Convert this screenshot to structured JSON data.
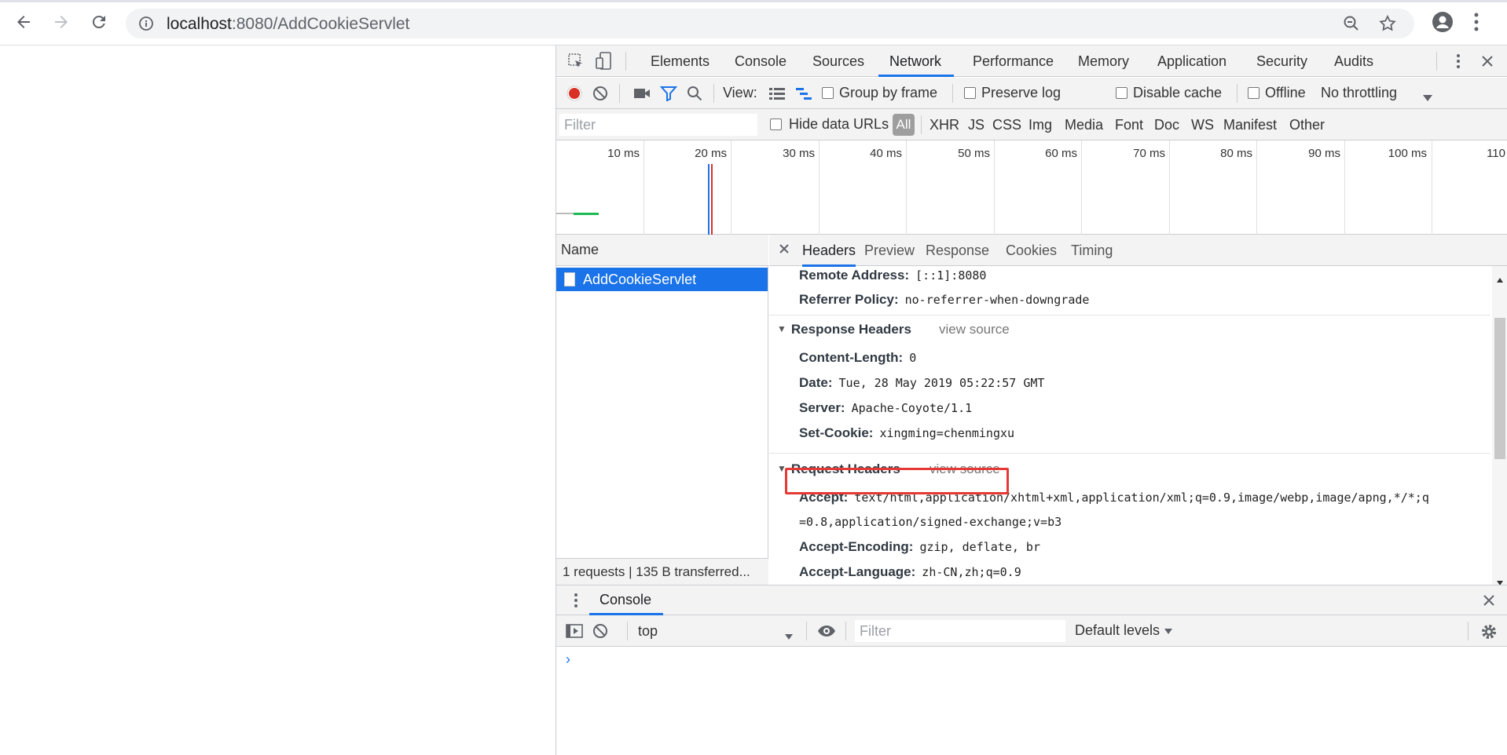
{
  "browser": {
    "url_host": "localhost",
    "url_rest": ":8080/AddCookieServlet"
  },
  "devtools": {
    "panel_tabs": [
      "Elements",
      "Console",
      "Sources",
      "Network",
      "Performance",
      "Memory",
      "Application",
      "Security",
      "Audits"
    ],
    "active_tab": "Network",
    "toolbar": {
      "view_label": "View:",
      "group_by_frame": "Group by frame",
      "preserve_log": "Preserve log",
      "disable_cache": "Disable cache",
      "offline": "Offline",
      "throttling": "No throttling"
    },
    "filter": {
      "placeholder": "Filter",
      "hide_data_urls": "Hide data URLs",
      "types": [
        "All",
        "XHR",
        "JS",
        "CSS",
        "Img",
        "Media",
        "Font",
        "Doc",
        "WS",
        "Manifest",
        "Other"
      ],
      "active_type": "All"
    },
    "timeline": {
      "ticks": [
        "10 ms",
        "20 ms",
        "30 ms",
        "40 ms",
        "50 ms",
        "60 ms",
        "70 ms",
        "80 ms",
        "90 ms",
        "100 ms",
        "110"
      ]
    },
    "requests": {
      "column_header": "Name",
      "items": [
        "AddCookieServlet"
      ],
      "summary": "1 requests  |  135 B transferred..."
    },
    "detail": {
      "tabs": [
        "Headers",
        "Preview",
        "Response",
        "Cookies",
        "Timing"
      ],
      "active_tab": "Headers",
      "general": [
        {
          "name": "Remote Address:",
          "value": "[::1]:8080"
        },
        {
          "name": "Referrer Policy:",
          "value": "no-referrer-when-downgrade"
        }
      ],
      "response_headers_title": "Response Headers",
      "request_headers_title": "Request Headers",
      "view_source": "view source",
      "response_headers": [
        {
          "name": "Content-Length:",
          "value": "0"
        },
        {
          "name": "Date:",
          "value": "Tue, 28 May 2019 05:22:57 GMT"
        },
        {
          "name": "Server:",
          "value": "Apache-Coyote/1.1"
        },
        {
          "name": "Set-Cookie:",
          "value": "xingming=chenmingxu"
        }
      ],
      "request_headers": [
        {
          "name": "Accept:",
          "value": "text/html,application/xhtml+xml,application/xml;q=0.9,image/webp,image/apng,*/*;q",
          "cont": "=0.8,application/signed-exchange;v=b3"
        },
        {
          "name": "Accept-Encoding:",
          "value": "gzip, deflate, br"
        },
        {
          "name": "Accept-Language:",
          "value": "zh-CN,zh;q=0.9"
        }
      ]
    },
    "console_drawer": {
      "tab": "Console",
      "context": "top",
      "filter_placeholder": "Filter",
      "levels": "Default levels",
      "prompt": "›"
    }
  },
  "colors": {
    "accent": "#1a73e8",
    "highlight": "#e53935",
    "record": "#d93025"
  }
}
